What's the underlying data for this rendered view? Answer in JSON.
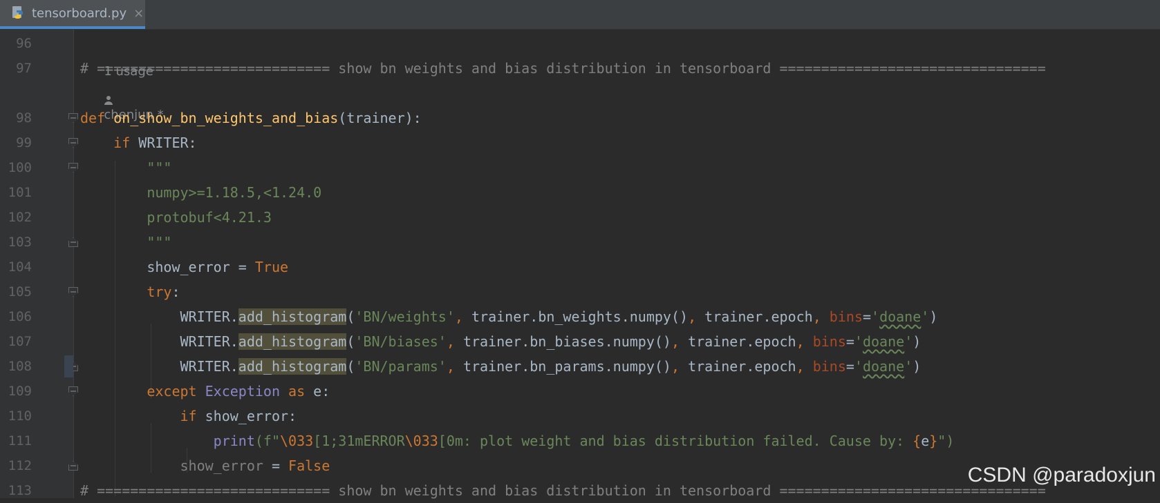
{
  "tab": {
    "filename": "tensorboard.py",
    "icon": "python-file-icon",
    "close": "×"
  },
  "hint": {
    "usage": "1 usage",
    "author": "chenjun *"
  },
  "line_numbers": [
    "96",
    "97",
    "98",
    "99",
    "100",
    "101",
    "102",
    "103",
    "104",
    "105",
    "106",
    "107",
    "108",
    "109",
    "110",
    "111",
    "112",
    "113"
  ],
  "code": {
    "l97": "# ============================ show bn weights and bias distribution in tensorboard ================================",
    "l98_def": "def",
    "l98_name": "on_show_bn_weights_and_bias",
    "l98_rest": "(trainer):",
    "l99_if": "if",
    "l99_rest": " WRITER:",
    "l100": "\"\"\"",
    "l101": "numpy>=1.18.5,<1.24.0",
    "l102": "protobuf<4.21.3",
    "l103": "\"\"\"",
    "l104_a": "show_error = ",
    "l104_b": "True",
    "l105_a": "try",
    "l105_b": ":",
    "writer": "WRITER.",
    "add_histogram": "add_histogram",
    "paren": "(",
    "l106_str": "'BN/weights'",
    "l106_mid": "trainer.bn_weights.numpy()",
    "l107_str": "'BN/biases'",
    "l107_mid": "trainer.bn_biases.numpy()",
    "l108_str": "'BN/params'",
    "l108_mid": "trainer.bn_params.numpy()",
    "comma": ", ",
    "epoch": "trainer.epoch",
    "bins": "bins",
    "eq": "=",
    "q": "'",
    "doane": "doane",
    "close": ")",
    "l109_except": "except",
    "l109_exc": "Exception",
    "l109_as": "as",
    "l109_e": " e:",
    "l110_if": "if",
    "l110_rest": " show_error:",
    "l111_print": "print",
    "l111_f": "(f\"",
    "l111_esc1": "\\033",
    "l111_s1": "[1;31mERROR",
    "l111_esc2": "\\033",
    "l111_s2": "[0m: plot weight and bias distribution failed. Cause by: ",
    "l111_b1": "{",
    "l111_e": "e",
    "l111_b2": "}",
    "l111_end": "\")",
    "l112_a": "show_error",
    "l112_b": " = ",
    "l112_c": "False",
    "l113": "# ============================ show bn weights and bias distribution in tensorboard ================================"
  },
  "watermark": "CSDN @paradoxjun"
}
